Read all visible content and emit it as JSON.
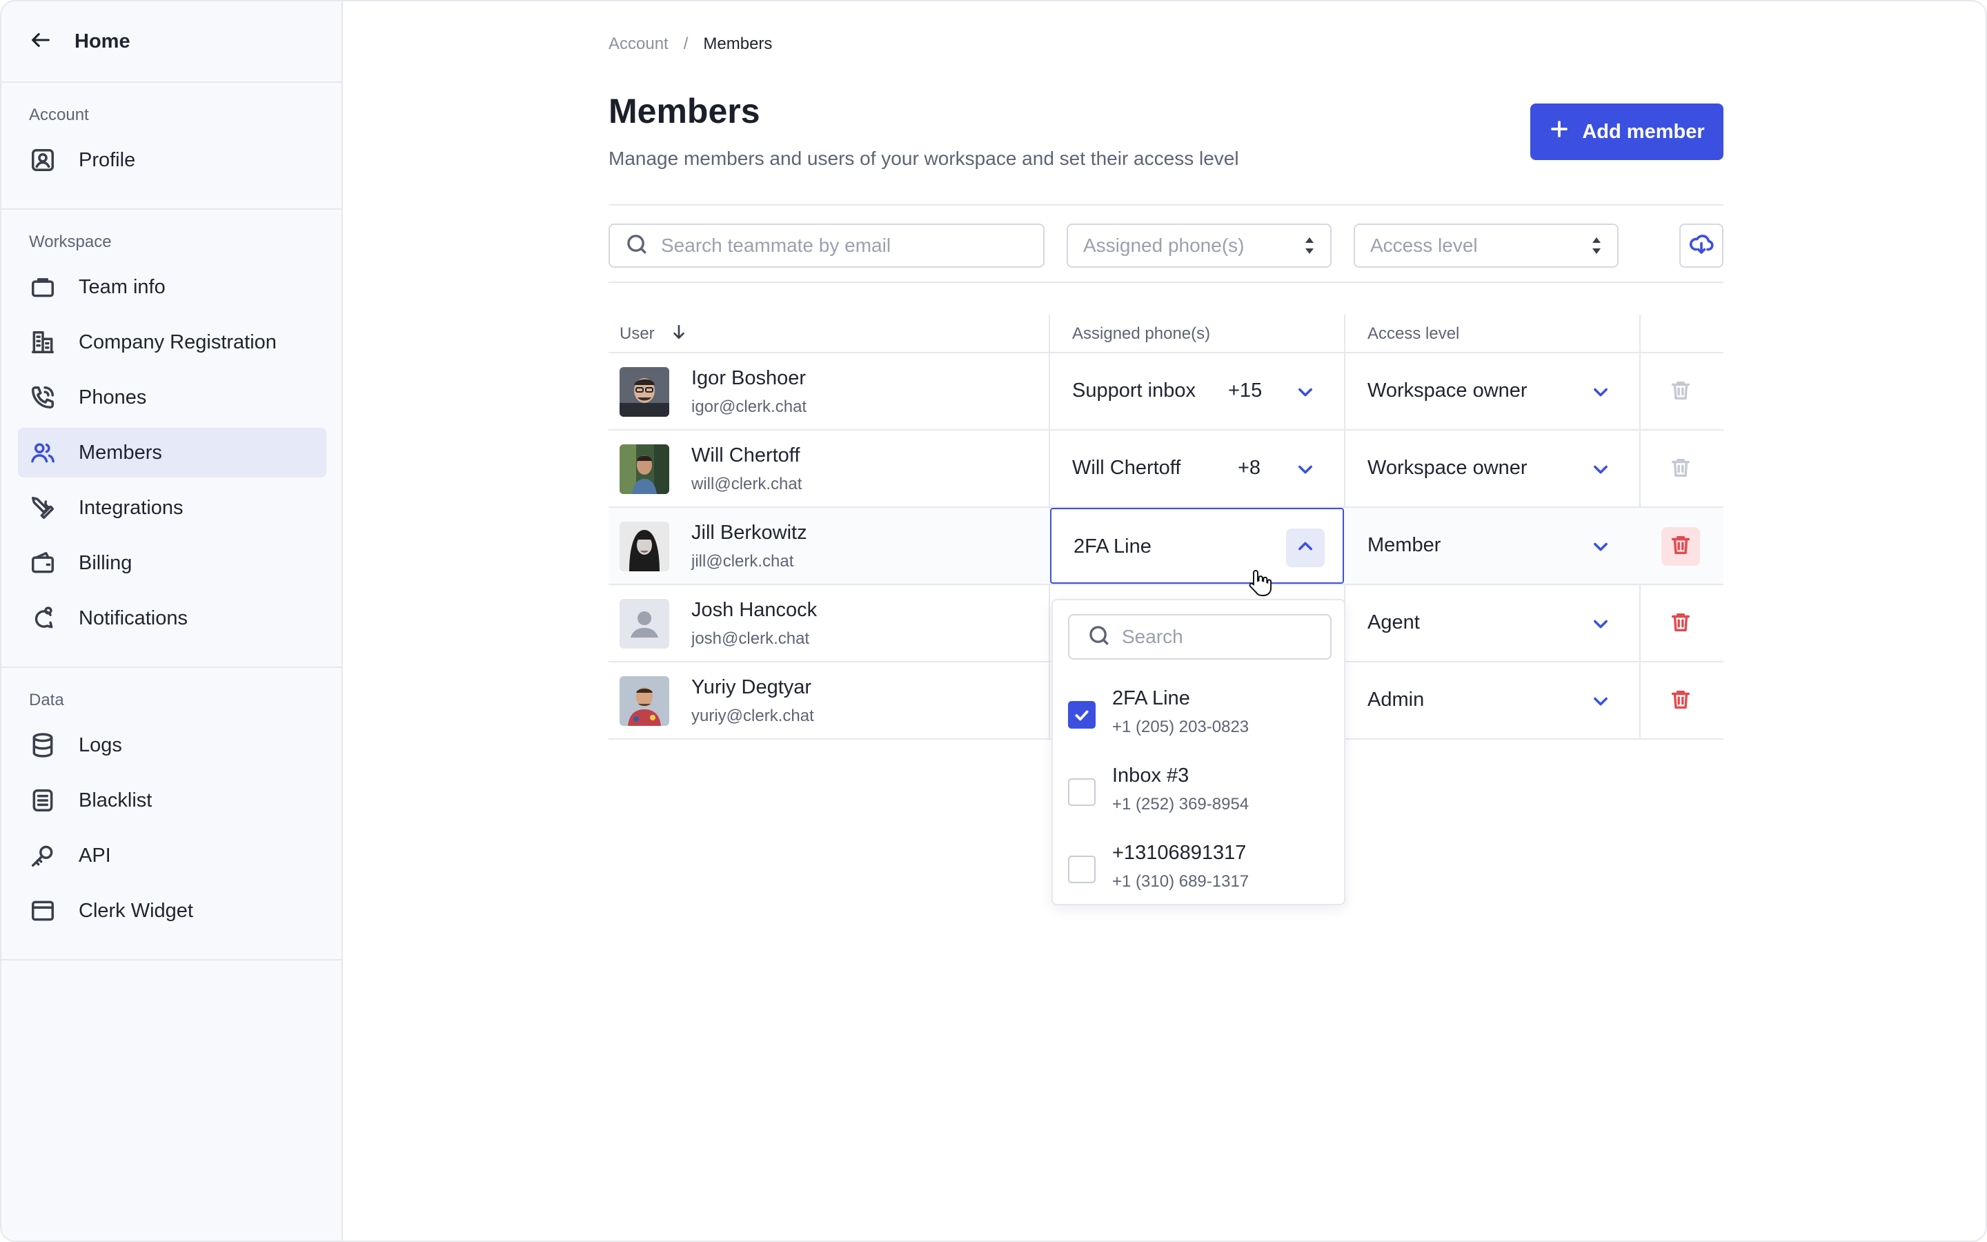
{
  "sidebar": {
    "home_label": "Home",
    "sections": [
      {
        "title": "Account",
        "items": [
          {
            "label": "Profile",
            "icon": "profile-icon"
          }
        ]
      },
      {
        "title": "Workspace",
        "items": [
          {
            "label": "Team info",
            "icon": "briefcase-icon"
          },
          {
            "label": "Company Registration",
            "icon": "building-icon"
          },
          {
            "label": "Phones",
            "icon": "phone-icon"
          },
          {
            "label": "Members",
            "icon": "users-icon",
            "active": true
          },
          {
            "label": "Integrations",
            "icon": "tools-icon"
          },
          {
            "label": "Billing",
            "icon": "wallet-icon"
          },
          {
            "label": "Notifications",
            "icon": "bell-icon"
          }
        ]
      },
      {
        "title": "Data",
        "items": [
          {
            "label": "Logs",
            "icon": "database-icon"
          },
          {
            "label": "Blacklist",
            "icon": "list-icon"
          },
          {
            "label": "API",
            "icon": "key-icon"
          },
          {
            "label": "Clerk Widget",
            "icon": "widget-icon"
          }
        ]
      }
    ]
  },
  "breadcrumb": {
    "parent": "Account",
    "separator": "/",
    "current": "Members"
  },
  "header": {
    "title": "Members",
    "subtitle": "Manage members and users of your workspace and set their access level",
    "add_button": "Add member"
  },
  "filters": {
    "search_placeholder": "Search teammate by email",
    "phones_placeholder": "Assigned phone(s)",
    "access_placeholder": "Access level"
  },
  "table": {
    "columns": {
      "user": "User",
      "phones": "Assigned phone(s)",
      "access": "Access level"
    },
    "rows": [
      {
        "name": "Igor Boshoer",
        "email": "igor@clerk.chat",
        "phone": "Support inbox",
        "count": "+15",
        "access": "Workspace owner",
        "delete_enabled": false
      },
      {
        "name": "Will Chertoff",
        "email": "will@clerk.chat",
        "phone": "Will Chertoff",
        "count": "+8",
        "access": "Workspace owner",
        "delete_enabled": false
      },
      {
        "name": "Jill Berkowitz",
        "email": "jill@clerk.chat",
        "phone": "2FA Line",
        "count": "",
        "access": "Member",
        "delete_enabled": true,
        "open": true
      },
      {
        "name": "Josh Hancock",
        "email": "josh@clerk.chat",
        "phone": "",
        "count": "",
        "access": "Agent",
        "delete_enabled": true
      },
      {
        "name": "Yuriy Degtyar",
        "email": "yuriy@clerk.chat",
        "phone": "",
        "count": "",
        "access": "Admin",
        "delete_enabled": true
      }
    ]
  },
  "dropdown": {
    "search_placeholder": "Search",
    "options": [
      {
        "name": "2FA Line",
        "number": "+1 (205) 203-0823",
        "checked": true
      },
      {
        "name": "Inbox #3",
        "number": "+1 (252) 369-8954",
        "checked": false
      },
      {
        "name": "+13106891317",
        "number": "+1 (310) 689-1317",
        "checked": false
      }
    ]
  },
  "colors": {
    "accent": "#3b50e0",
    "danger": "#e5484d",
    "active_bg": "#e5e9f8"
  }
}
